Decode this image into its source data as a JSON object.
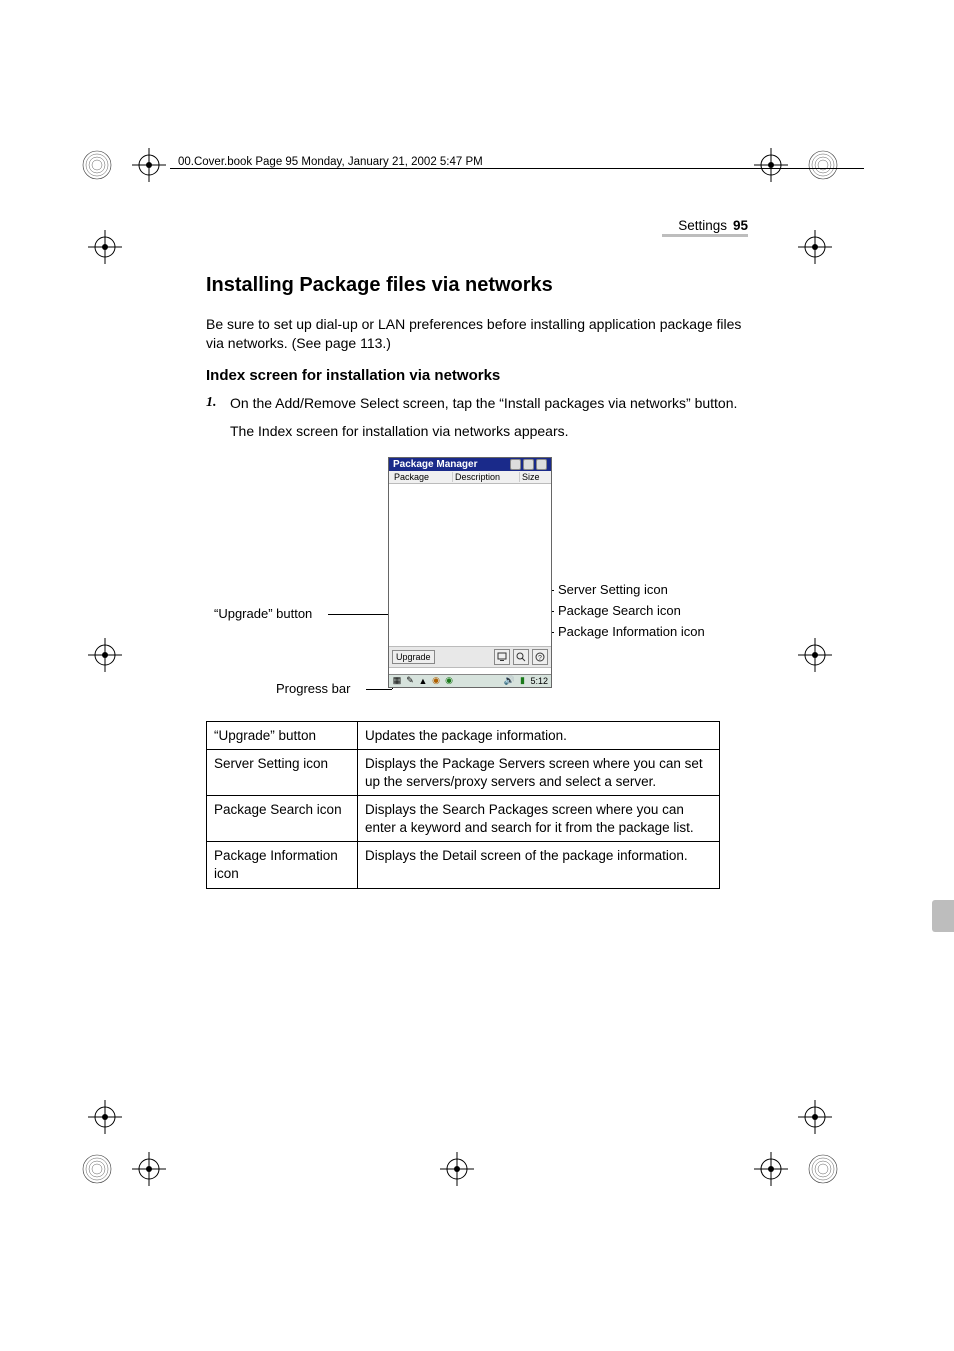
{
  "running_header": "00.Cover.book  Page 95  Monday, January 21, 2002  5:47 PM",
  "chapter": {
    "label": "Settings",
    "page": "95"
  },
  "h2": "Installing Package files via networks",
  "intro": "Be sure to set up dial-up or LAN preferences before installing application package files via networks. (See page 113.)",
  "h3": "Index screen for installation via networks",
  "step1_num": "1.",
  "step1_text": "On the Add/Remove Select screen, tap the “Install packages via networks” button.",
  "figcap": "The Index screen for installation via networks appears.",
  "device": {
    "title": "Package Manager",
    "cols": {
      "c1": "Package",
      "c2": "Description",
      "c3": "Size"
    },
    "upgrade": "Upgrade",
    "clock": "5:12"
  },
  "callouts": {
    "upgrade": "“Upgrade” button",
    "server": "Server Setting icon",
    "search": "Package Search icon",
    "info": "Package Information icon",
    "progress": "Progress bar"
  },
  "table": [
    {
      "k": "“Upgrade” button",
      "v": "Updates the package information."
    },
    {
      "k": "Server Setting icon",
      "v": "Displays the Package Servers screen where you can set up the servers/proxy servers and select a server."
    },
    {
      "k": "Package Search icon",
      "v": "Displays the Search Packages screen where you can enter a keyword and search for it from the package list."
    },
    {
      "k": "Package Information icon",
      "v": "Displays the Detail screen of the package information."
    }
  ]
}
